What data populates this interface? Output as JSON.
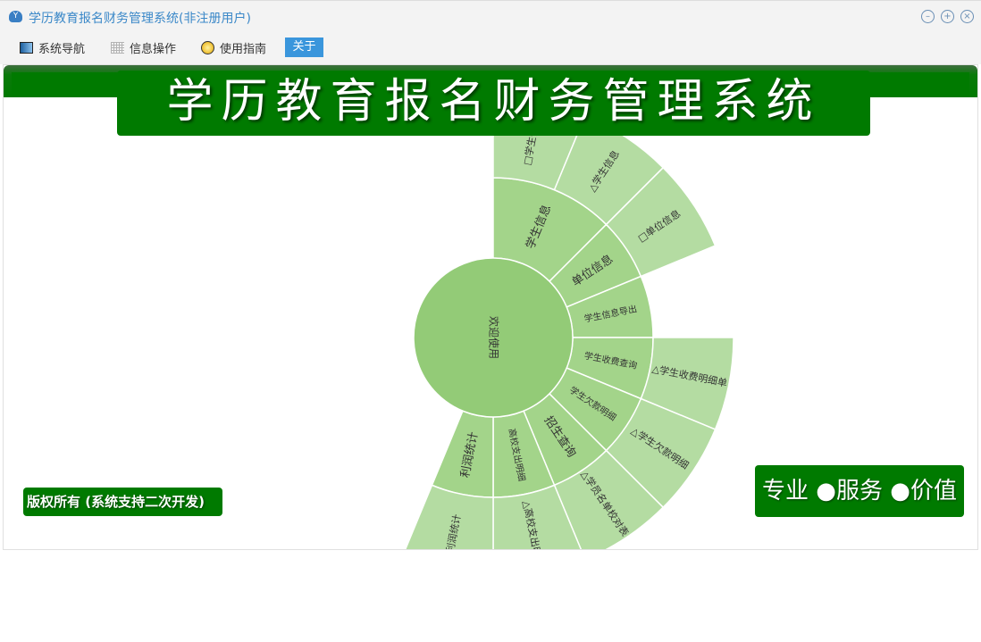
{
  "window": {
    "title": "学历教育报名财务管理系统(非注册用户)",
    "controls": [
      "minimize",
      "restore",
      "close"
    ]
  },
  "menu": [
    {
      "label": "系统导航",
      "icon": "monitor-icon"
    },
    {
      "label": "信息操作",
      "icon": "grid-icon"
    },
    {
      "label": "使用指南",
      "icon": "help-icon"
    },
    {
      "label": "关于",
      "icon": ""
    }
  ],
  "banner": {
    "title": "学历教育报名财务管理系统"
  },
  "footer": {
    "copyright": "版权所有 (系统支持二次开发)",
    "slogan": "专业 ●服务 ●价值"
  },
  "colors": {
    "brand_green": "#007a00",
    "ring1": "#93cb77",
    "ring2": "#a3d48a",
    "ring3": "#b4dca2",
    "accent_blue": "#3a96dc"
  },
  "sunburst": {
    "root": "欢迎使用",
    "start_angle_deg": -90,
    "degrees_per_unit": 22.5,
    "children": [
      {
        "name": "学生信息",
        "value": 2,
        "children": [
          {
            "name": "□学生信息",
            "value": 1
          },
          {
            "name": "△学生信息",
            "value": 1
          }
        ]
      },
      {
        "name": "单位信息",
        "value": 1,
        "children": [
          {
            "name": "□单位信息",
            "value": 1
          }
        ]
      },
      {
        "name": "学生信息导出",
        "value": 1,
        "children": []
      },
      {
        "name": "学生收费查询",
        "value": 1,
        "children": [
          {
            "name": "△学生收费明细单",
            "value": 1
          }
        ]
      },
      {
        "name": "学生欠款明细",
        "value": 1,
        "children": [
          {
            "name": "△学生欠款明细",
            "value": 1
          }
        ]
      },
      {
        "name": "招生查询",
        "value": 1,
        "children": [
          {
            "name": "△学员名单校对表",
            "value": 1
          }
        ]
      },
      {
        "name": "高校支出明细",
        "value": 1,
        "children": [
          {
            "name": "△高校支出明细",
            "value": 1
          }
        ]
      },
      {
        "name": "利润统计",
        "value": 1,
        "children": [
          {
            "name": "利润统计",
            "value": 1
          }
        ]
      }
    ]
  }
}
